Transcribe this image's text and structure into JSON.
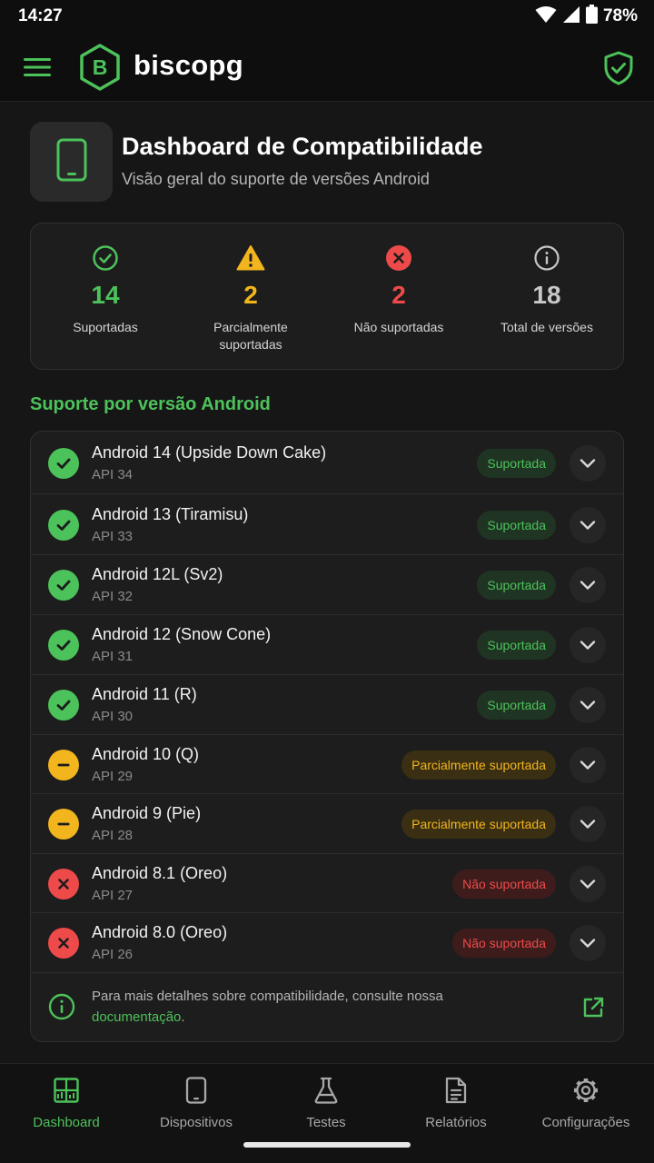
{
  "status_bar": {
    "time": "14:27",
    "battery": "78%"
  },
  "app_bar": {
    "brand": "biscopg"
  },
  "header": {
    "title": "Dashboard de Compatibilidade",
    "subtitle": "Visão geral do suporte de versões Android"
  },
  "stats": [
    {
      "value": "14",
      "label": "Suportadas",
      "color": "#4cc25a",
      "icon": "check-circle-icon"
    },
    {
      "value": "2",
      "label": "Parcialmente suportadas",
      "color": "#f2b51e",
      "icon": "warning-icon"
    },
    {
      "value": "2",
      "label": "Não suportadas",
      "color": "#ee4a4a",
      "icon": "x-circle-icon"
    },
    {
      "value": "18",
      "label": "Total de versões",
      "color": "#c8c8c8",
      "icon": "info-icon"
    }
  ],
  "section_title": "Suporte por versão Android",
  "versions": [
    {
      "name": "Android 14 (Upside Down Cake)",
      "api": "API 34",
      "status": "Suportada"
    },
    {
      "name": "Android 13 (Tiramisu)",
      "api": "API 33",
      "status": "Suportada"
    },
    {
      "name": "Android 12L (Sv2)",
      "api": "API 32",
      "status": "Suportada"
    },
    {
      "name": "Android 12 (Snow Cone)",
      "api": "API 31",
      "status": "Suportada"
    },
    {
      "name": "Android 11 (R)",
      "api": "API 30",
      "status": "Suportada"
    },
    {
      "name": "Android 10 (Q)",
      "api": "API 29",
      "status": "Parcialmente suportada"
    },
    {
      "name": "Android 9 (Pie)",
      "api": "API 28",
      "status": "Parcialmente suportada"
    },
    {
      "name": "Android 8.1 (Oreo)",
      "api": "API 27",
      "status": "Não suportada"
    },
    {
      "name": "Android 8.0 (Oreo)",
      "api": "API 26",
      "status": "Não suportada"
    }
  ],
  "footer": {
    "text": "Para mais detalhes sobre compatibilidade, consulte nossa",
    "link": "documentação",
    "suffix": "."
  },
  "nav": [
    {
      "label": "Dashboard",
      "icon": "dashboard-icon",
      "active": true
    },
    {
      "label": "Dispositivos",
      "icon": "device-icon",
      "active": false
    },
    {
      "label": "Testes",
      "icon": "flask-icon",
      "active": false
    },
    {
      "label": "Relatórios",
      "icon": "report-icon",
      "active": false
    },
    {
      "label": "Configurações",
      "icon": "gear-icon",
      "active": false
    }
  ],
  "colors": {
    "accent": "#4cc25a",
    "warning": "#f2b51e",
    "error": "#ee4a4a"
  }
}
